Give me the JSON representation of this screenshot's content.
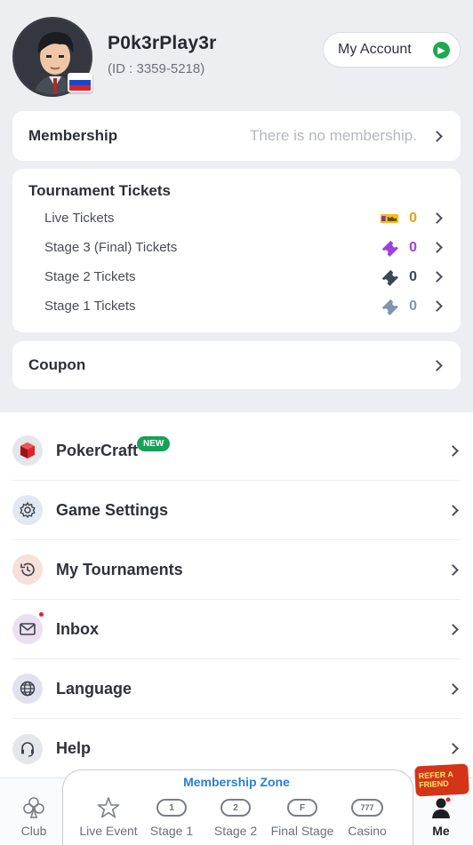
{
  "user": {
    "name": "P0k3rPlay3r",
    "id_text": "(ID : 3359-5218)"
  },
  "account_button": "My Account",
  "membership": {
    "label": "Membership",
    "status": "There is no membership."
  },
  "tournament_tickets": {
    "title": "Tournament Tickets",
    "rows": [
      {
        "label": "Live Tickets",
        "count": "0",
        "color": "#e0a21c"
      },
      {
        "label": "Stage 3 (Final) Tickets",
        "count": "0",
        "color": "#a03fe0"
      },
      {
        "label": "Stage 2 Tickets",
        "count": "0",
        "color": "#3c4654"
      },
      {
        "label": "Stage 1 Tickets",
        "count": "0",
        "color": "#7f95ad"
      }
    ]
  },
  "coupon": {
    "label": "Coupon"
  },
  "menu": {
    "pokercraft": "PokerCraft",
    "new_badge": "NEW",
    "game_settings": "Game Settings",
    "my_tournaments": "My Tournaments",
    "inbox": "Inbox",
    "language": "Language",
    "help": "Help"
  },
  "bottom_nav": {
    "zone_title": "Membership Zone",
    "club": "Club",
    "live_event": "Live Event",
    "stage1": "Stage 1",
    "stage1_icon": "1",
    "stage2": "Stage 2",
    "stage2_icon": "2",
    "final_stage": "Final Stage",
    "final_icon": "F",
    "casino": "Casino",
    "casino_icon": "777",
    "me": "Me",
    "refer_banner": "REFER A FRIEND"
  },
  "colors": {
    "accent_green": "#1fa84f",
    "zone_blue": "#2a7fd4",
    "alert_red": "#e8202a"
  }
}
